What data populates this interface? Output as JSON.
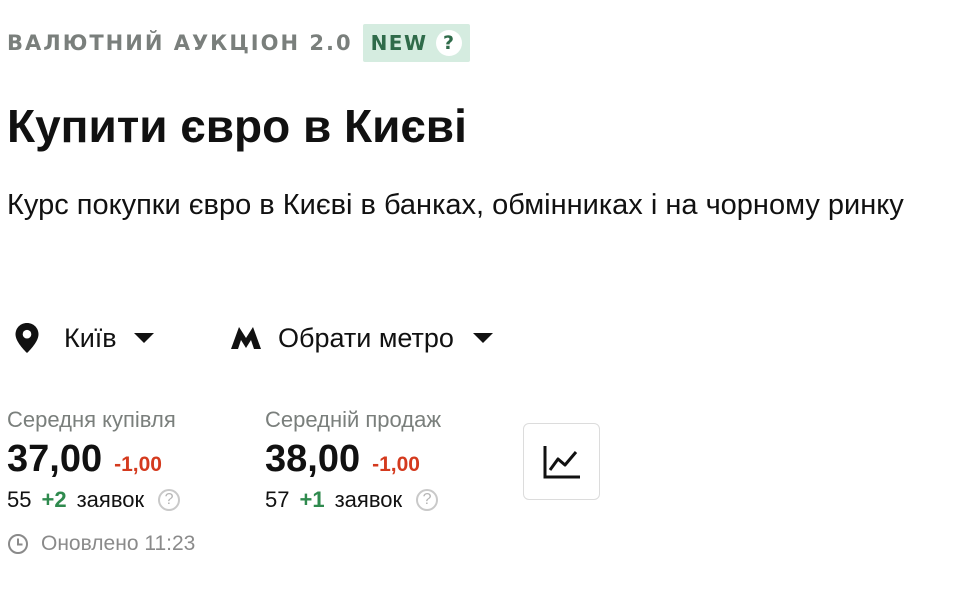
{
  "auction": {
    "label": "ВАЛЮТНИЙ АУКЦІОН 2.0",
    "badge": "NEW",
    "help_glyph": "?",
    "badge_bg": "#d5ece0",
    "badge_fg": "#2f6b4a"
  },
  "page": {
    "title": "Купити євро в Києві",
    "subtitle": "Курс покупки євро в Києві в банках, обмінниках і на чорному ринку"
  },
  "filters": {
    "city": {
      "icon": "location-pin-icon",
      "label": "Київ"
    },
    "metro": {
      "icon": "metro-icon",
      "label": "Обрати метро"
    }
  },
  "stats": {
    "buy": {
      "label": "Середня купівля",
      "value": "37,00",
      "delta": "-1,00",
      "orders_count": "55",
      "orders_delta": "+2",
      "orders_word": "заявок"
    },
    "sell": {
      "label": "Середній продаж",
      "value": "38,00",
      "delta": "-1,00",
      "orders_count": "57",
      "orders_delta": "+1",
      "orders_word": "заявок"
    },
    "help_glyph": "?",
    "colors": {
      "negative": "#d43a1e",
      "positive": "#2f8a4e",
      "muted": "#7a7f7c"
    }
  },
  "chart_button": {
    "icon": "line-chart-icon"
  },
  "updated": {
    "icon": "clock-icon",
    "text": "Оновлено 11:23"
  }
}
